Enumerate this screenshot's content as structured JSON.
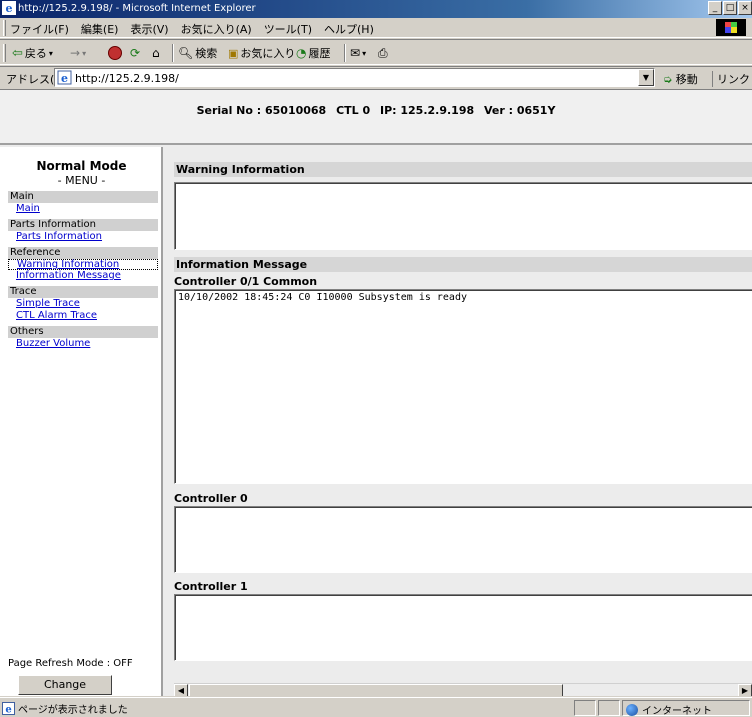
{
  "window": {
    "title": "http://125.2.9.198/ - Microsoft Internet Explorer",
    "controls": [
      "_",
      "□",
      "×"
    ]
  },
  "menubar": {
    "items": [
      "ファイル(F)",
      "編集(E)",
      "表示(V)",
      "お気に入り(A)",
      "ツール(T)",
      "ヘルプ(H)"
    ]
  },
  "toolbar": {
    "back": "戻る",
    "forward": "→",
    "search": "検索",
    "favorites": "お気に入り",
    "history": "履歴"
  },
  "addressbar": {
    "label": "アドレス(D)",
    "url": "http://125.2.9.198/",
    "go": "移動",
    "links": "リンク »"
  },
  "header": {
    "serial": "Serial No : 65010068",
    "ctl": "CTL 0",
    "ip": "IP: 125.2.9.198",
    "ver": "Ver : 0651Y"
  },
  "sidebar": {
    "mode": "Normal Mode",
    "menu_title": "- MENU -",
    "sections": [
      {
        "label": "Main",
        "links": [
          "Main"
        ]
      },
      {
        "label": "Parts Information",
        "links": [
          "Parts Information"
        ]
      },
      {
        "label": "Reference",
        "links": [
          "Warning Information",
          "Information Message"
        ]
      },
      {
        "label": "Trace",
        "links": [
          "Simple Trace",
          "CTL Alarm Trace"
        ]
      },
      {
        "label": "Others",
        "links": [
          "Buzzer Volume"
        ]
      }
    ],
    "refresh": "Page Refresh Mode : OFF",
    "change_button": "Change"
  },
  "content": {
    "warning_header": "Warning Information",
    "info_header": "Information Message",
    "common_header": "Controller 0/1 Common",
    "common_message": "10/10/2002 18:45:24 C0 I10000 Subsystem is ready",
    "ctl0_header": "Controller 0",
    "ctl1_header": "Controller 1"
  },
  "statusbar": {
    "status": "ページが表示されました",
    "zone": "インターネット"
  }
}
